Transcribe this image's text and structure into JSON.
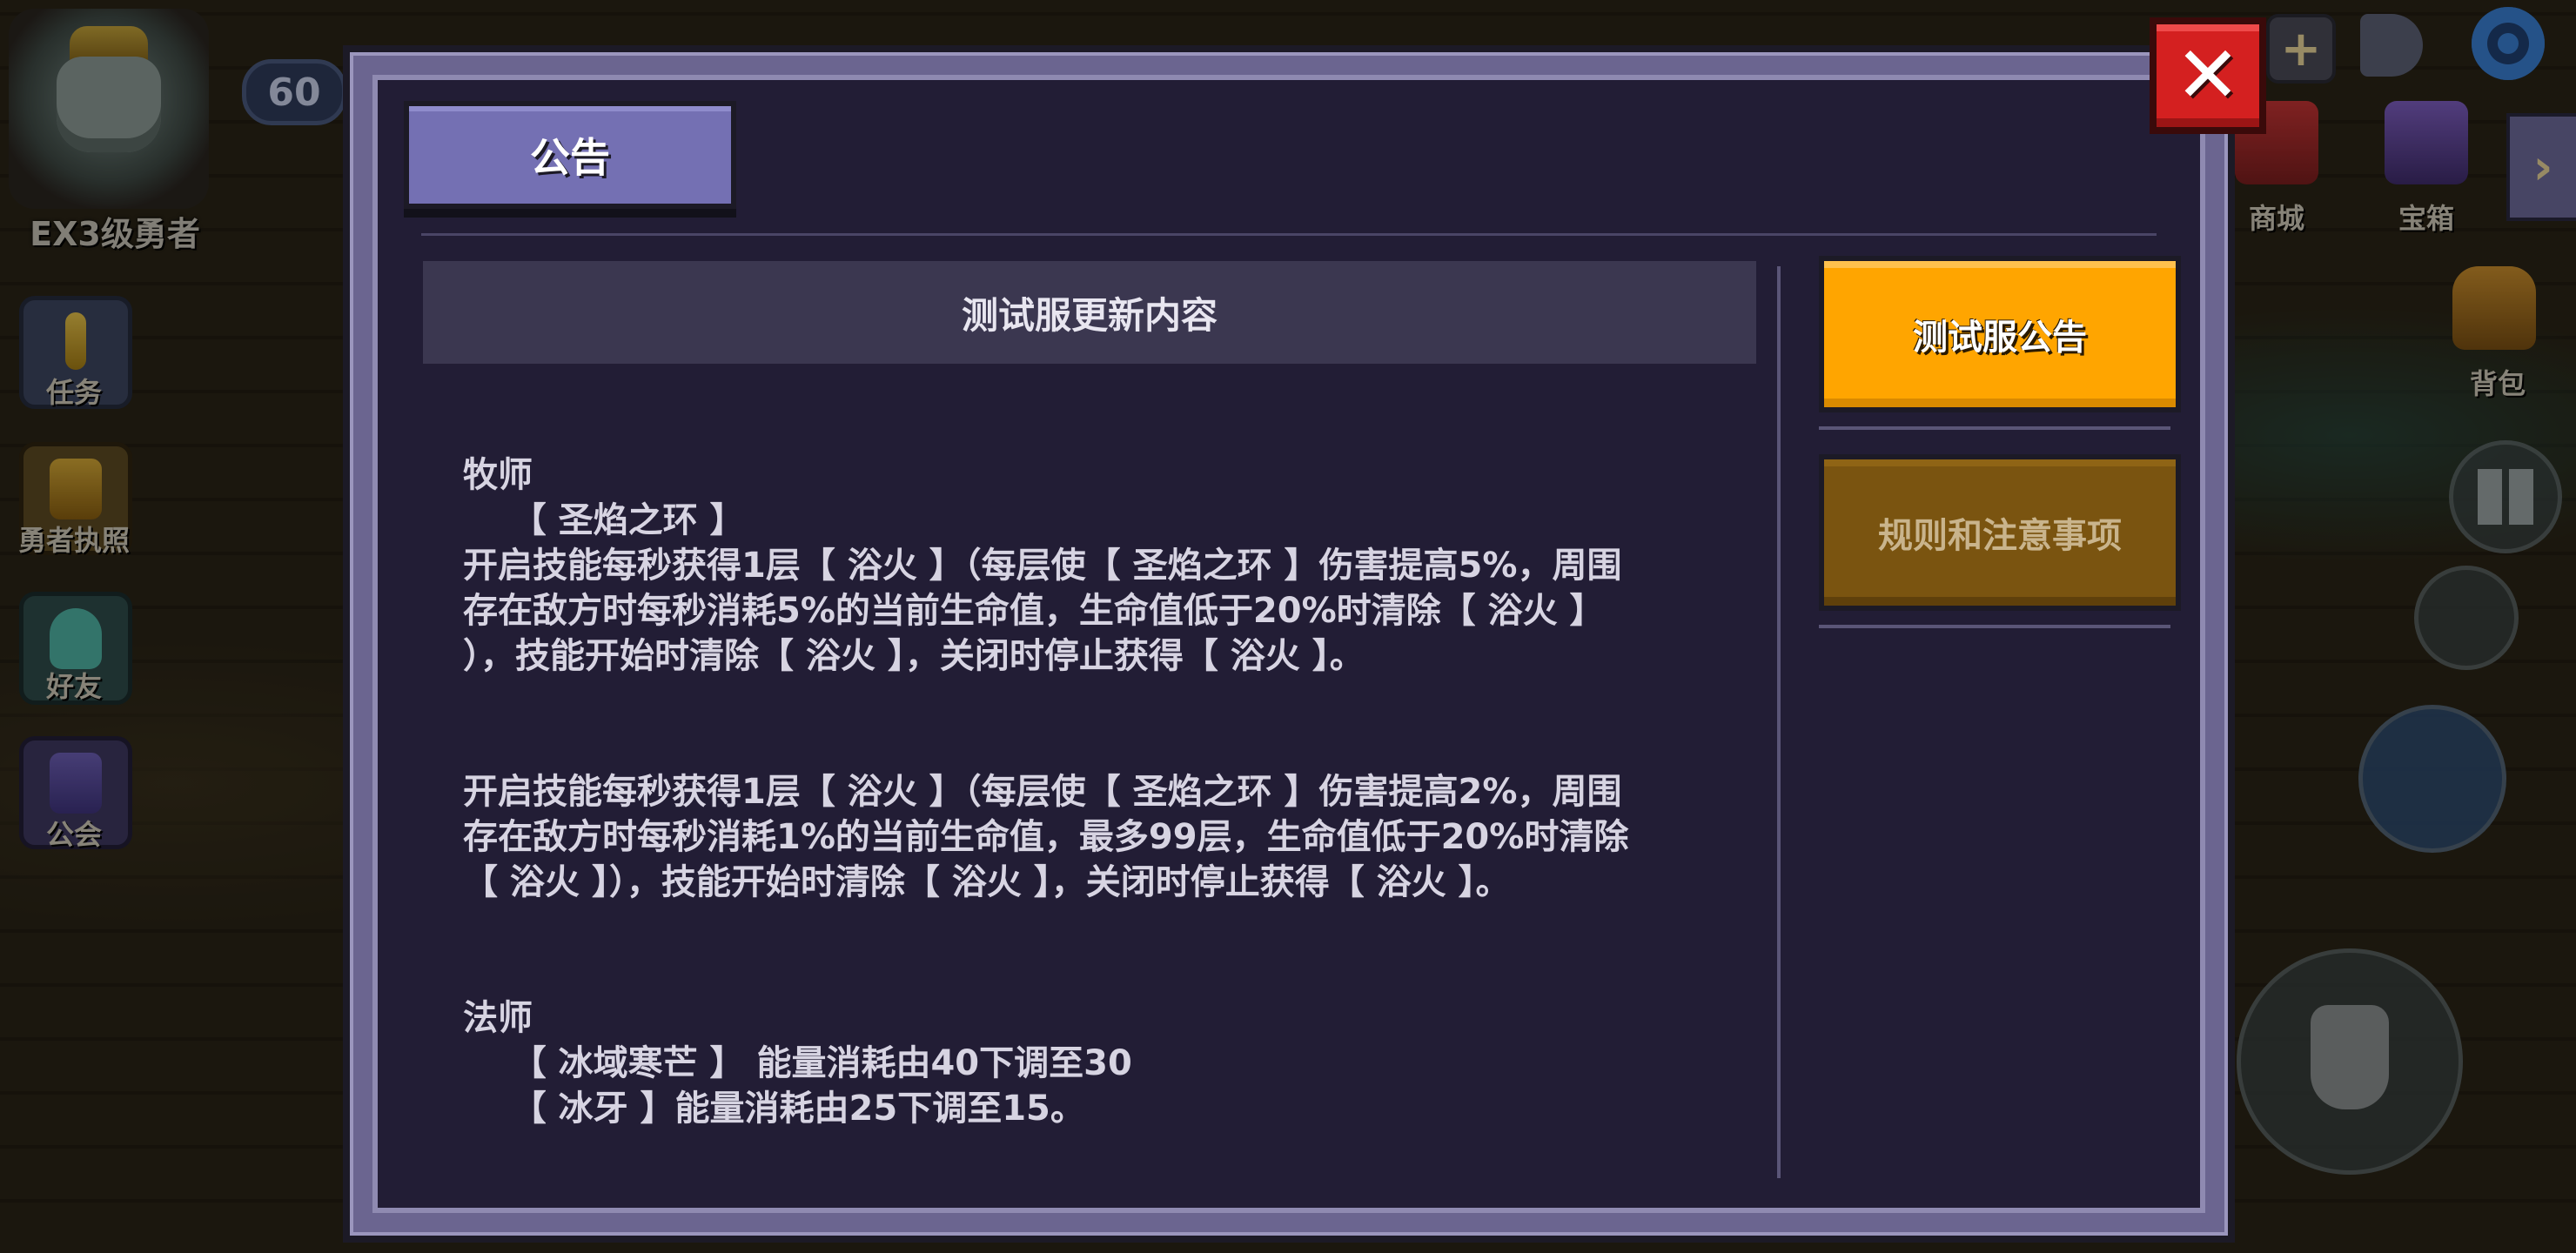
{
  "hud": {
    "level": "60",
    "rank_label": "EX3级勇者",
    "left_menu": [
      {
        "label": "任务",
        "icon": "exclamation-quest-icon"
      },
      {
        "label": "勇者执照",
        "icon": "license-badge-icon"
      },
      {
        "label": "好友",
        "icon": "friend-icon"
      },
      {
        "label": "公会",
        "icon": "guild-banner-icon"
      }
    ],
    "right_menu": [
      {
        "label": "商城",
        "icon": "shop-icon"
      },
      {
        "label": "宝箱",
        "icon": "treasure-chest-icon"
      },
      {
        "label": "背包",
        "icon": "backpack-icon"
      }
    ]
  },
  "dialog": {
    "tab_title": "公告",
    "close_label": "✕",
    "content_title": "测试服更新内容",
    "paragraphs": [
      "牧师\n    【 圣焰之环 】\n开启技能每秒获得1层【 浴火 】（每层使【 圣焰之环 】伤害提高5%，周围\n存在敌方时每秒消耗5%的当前生命值，生命值低于20%时清除【 浴火 】\n），技能开始时清除【 浴火 】，关闭时停止获得【 浴火 】。",
      "开启技能每秒获得1层【 浴火 】（每层使【 圣焰之环 】伤害提高2%，周围\n存在敌方时每秒消耗1%的当前生命值，最多99层，生命值低于20%时清除\n【 浴火 】），技能开始时清除【 浴火 】，关闭时停止获得【 浴火 】。",
      "法师\n    【 冰域寒芒 】 能量消耗由40下调至30\n    【 冰牙 】能量消耗由25下调至15。"
    ],
    "side_tabs": [
      {
        "label": "测试服公告",
        "active": true
      },
      {
        "label": "规则和注意事项",
        "active": false
      }
    ]
  },
  "colors": {
    "active_tab": "#ffa500",
    "inactive_tab": "#7a5410",
    "close_button": "#d42020",
    "title_tab": "#7470b3",
    "panel_bg": "#221d35"
  }
}
